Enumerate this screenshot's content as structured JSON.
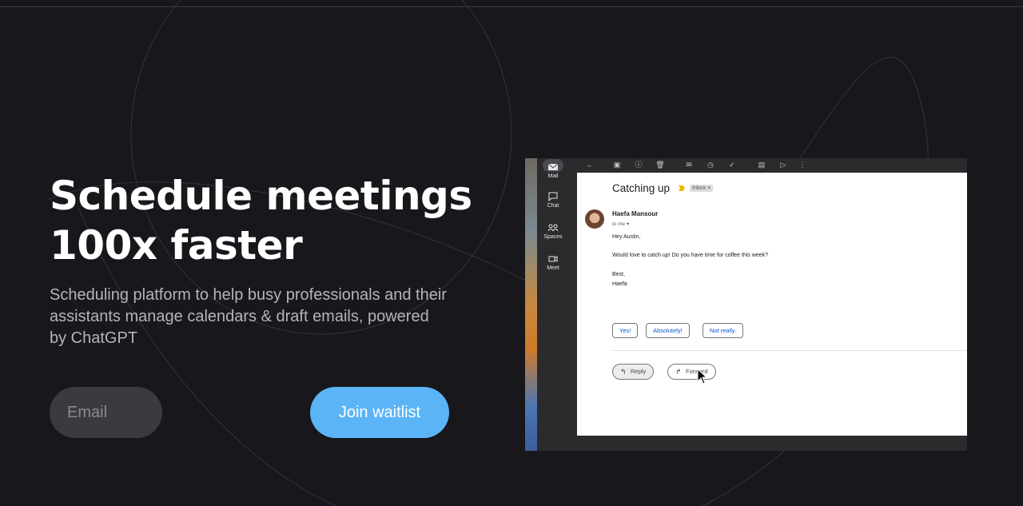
{
  "hero": {
    "title_line1": "Schedule meetings",
    "title_line2": "100x faster",
    "subtitle": "Scheduling platform to help busy professionals and their assistants manage calendars & draft emails, powered by ChatGPT"
  },
  "form": {
    "email_placeholder": "Email",
    "email_value": "",
    "join_label": "Join waitlist"
  },
  "colors": {
    "background": "#17171c",
    "accent": "#5bb4f5"
  },
  "screenshot": {
    "sidebar": [
      {
        "label": "Mail",
        "icon": "mail-icon",
        "active": true
      },
      {
        "label": "Chat",
        "icon": "chat-icon",
        "active": false
      },
      {
        "label": "Spaces",
        "icon": "spaces-icon",
        "active": false
      },
      {
        "label": "Meet",
        "icon": "meet-icon",
        "active": false
      }
    ],
    "toolbar_icons": [
      "back-arrow-icon",
      "archive-icon",
      "report-spam-icon",
      "delete-icon",
      "mark-unread-icon",
      "snooze-icon",
      "add-task-icon",
      "move-to-icon",
      "label-icon",
      "more-vert-icon"
    ],
    "email": {
      "subject": "Catching up",
      "label_chip": "Inbox ×",
      "sender": "Haefa Mansour",
      "recipient": "to me ▾",
      "greeting": "Hey Austin,",
      "body": "Would love to catch up! Do you have time for coffee this week?",
      "signoff": "Best,",
      "signature": "Haefa",
      "smart_replies": [
        "Yes!",
        "Absolutely!",
        "Not really."
      ],
      "reply_label": "Reply",
      "forward_label": "Forward"
    }
  }
}
